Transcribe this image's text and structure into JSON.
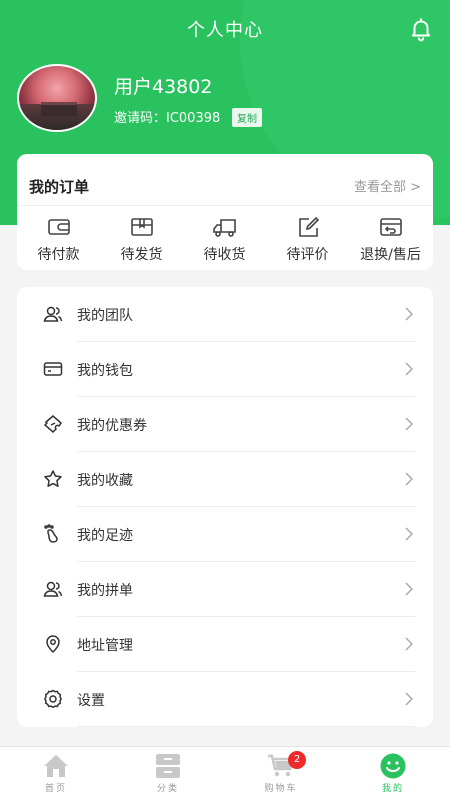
{
  "header": {
    "title": "个人中心",
    "bell_icon": "bell-icon"
  },
  "profile": {
    "username": "用户43802",
    "invite_label": "邀请码：IC00398",
    "copy_label": "复制"
  },
  "orders": {
    "title": "我的订单",
    "view_all": "查看全部 >",
    "items": [
      {
        "label": "待付款",
        "icon": "wallet-icon"
      },
      {
        "label": "待发货",
        "icon": "box-icon"
      },
      {
        "label": "待收货",
        "icon": "truck-icon"
      },
      {
        "label": "待评价",
        "icon": "edit-icon"
      },
      {
        "label": "退换/售后",
        "icon": "return-icon"
      }
    ]
  },
  "menu": {
    "items": [
      {
        "label": "我的团队",
        "icon": "team-icon"
      },
      {
        "label": "我的钱包",
        "icon": "card-icon"
      },
      {
        "label": "我的优惠券",
        "icon": "coupon-icon"
      },
      {
        "label": "我的收藏",
        "icon": "star-icon"
      },
      {
        "label": "我的足迹",
        "icon": "footprint-icon"
      },
      {
        "label": "我的拼单",
        "icon": "group-buy-icon"
      },
      {
        "label": "地址管理",
        "icon": "location-icon"
      },
      {
        "label": "设置",
        "icon": "gear-icon"
      }
    ]
  },
  "tabbar": {
    "items": [
      {
        "label": "首页",
        "icon": "home-icon"
      },
      {
        "label": "分类",
        "icon": "category-icon"
      },
      {
        "label": "购物车",
        "icon": "cart-icon",
        "badge": "2"
      },
      {
        "label": "我的",
        "icon": "smile-icon",
        "active": true
      }
    ]
  },
  "colors": {
    "brand": "#29c25e",
    "badge": "#f02a2a"
  }
}
